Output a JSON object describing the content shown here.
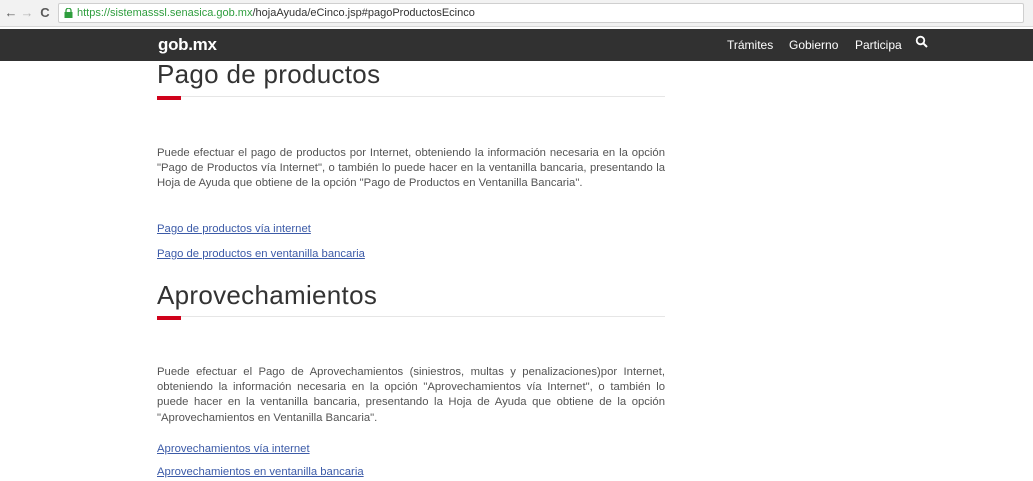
{
  "browser": {
    "url_host": "https://sistemasssl.senasica.gob.mx",
    "url_path": "/hojaAyuda/eCinco.jsp#pagoProductosEcinco"
  },
  "header": {
    "logo": "gob.mx",
    "menu": [
      "Trámites",
      "Gobierno",
      "Participa"
    ]
  },
  "sections": [
    {
      "title": "Pago de productos",
      "paragraph": "Puede efectuar el pago de productos por Internet, obteniendo la información necesaria en la opción \"Pago de Productos vía Internet\", o también lo puede hacer en la ventanilla bancaria, presentando la Hoja de Ayuda que obtiene de la opción \"Pago de Productos en Ventanilla Bancaria\".",
      "links": [
        "Pago de productos vía internet",
        "Pago de productos en ventanilla bancaria"
      ]
    },
    {
      "title": "Aprovechamientos",
      "paragraph": "Puede efectuar el Pago de Aprovechamientos (siniestros, multas y penalizaciones)por Internet, obteniendo la información necesaria en la opción \"Aprovechamientos vía Internet\", o también lo puede hacer en la ventanilla bancaria, presentando la Hoja de Ayuda que obtiene de la opción \"Aprovechamientos en Ventanilla Bancaria\".",
      "links": [
        "Aprovechamientos vía internet",
        "Aprovechamientos en ventanilla bancaria"
      ]
    }
  ],
  "colors": {
    "accent": "#d0021b",
    "header_bg": "#313131",
    "link": "#3c5ba8"
  },
  "icons": {
    "back": "arrow-left-icon",
    "forward": "arrow-right-icon",
    "reload": "reload-icon",
    "secure": "lock-icon",
    "search": "search-icon"
  }
}
